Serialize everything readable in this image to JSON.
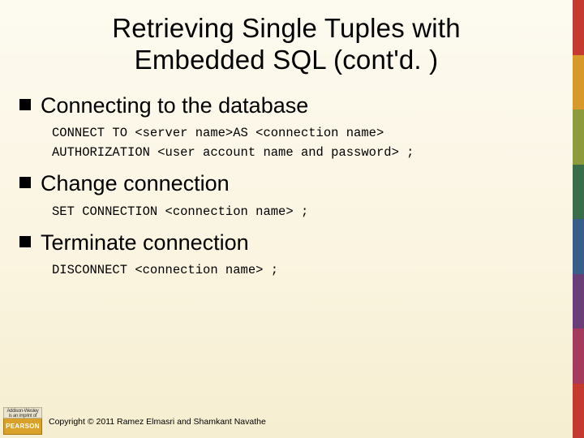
{
  "title_line1": "Retrieving Single Tuples with",
  "title_line2": "Embedded SQL (cont'd. )",
  "sections": [
    {
      "heading": "Connecting to the database",
      "code": "CONNECT TO <server name>AS <connection name>\nAUTHORIZATION <user account name and password> ;"
    },
    {
      "heading": "Change connection",
      "code": "SET CONNECTION <connection name> ;"
    },
    {
      "heading": "Terminate connection",
      "code": "DISCONNECT <connection name> ;"
    }
  ],
  "logo": {
    "top": "Addison-Wesley",
    "sub": "is an imprint of",
    "brand": "PEARSON"
  },
  "copyright": "Copyright © 2011 Ramez Elmasri and Shamkant Navathe"
}
